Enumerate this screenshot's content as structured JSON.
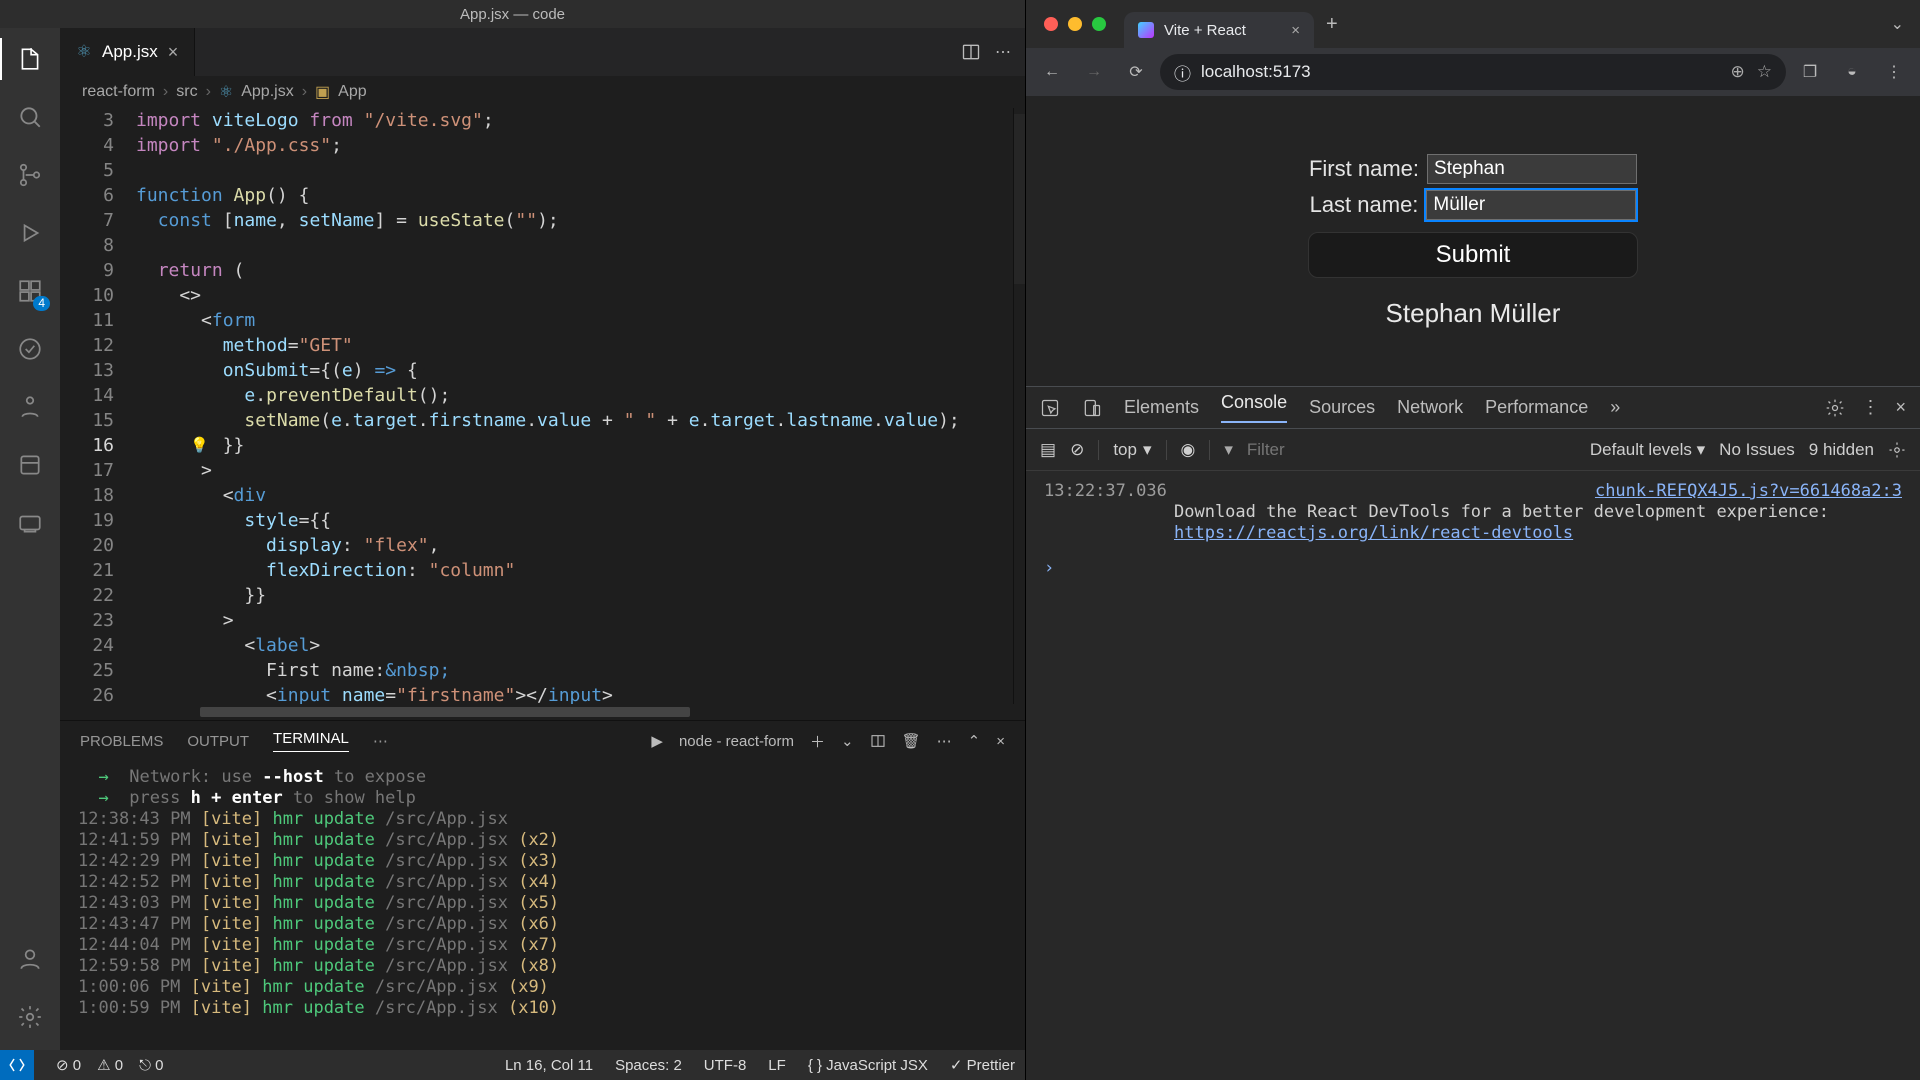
{
  "vscode": {
    "title": "App.jsx — code",
    "tab": {
      "label": "App.jsx"
    },
    "breadcrumb": [
      "react-form",
      "src",
      "App.jsx",
      "App"
    ],
    "activity_badge": "4",
    "code_lines": [
      {
        "n": 3,
        "html": "<span class='kw'>import</span> <span class='var'>viteLogo</span> <span class='kw'>from</span> <span class='str'>\"/vite.svg\"</span>;"
      },
      {
        "n": 4,
        "html": "<span class='kw'>import</span> <span class='str'>\"./App.css\"</span>;"
      },
      {
        "n": 5,
        "html": ""
      },
      {
        "n": 6,
        "html": "<span class='blue'>function</span> <span class='fn'>App</span>() {"
      },
      {
        "n": 7,
        "html": "  <span class='blue'>const</span> [<span class='var'>name</span>, <span class='var'>setName</span>] = <span class='fn'>useState</span>(<span class='str'>\"\"</span>);"
      },
      {
        "n": 8,
        "html": ""
      },
      {
        "n": 9,
        "html": "  <span class='kw'>return</span> ("
      },
      {
        "n": 10,
        "html": "    &lt;&gt;"
      },
      {
        "n": 11,
        "html": "      &lt;<span class='blue'>form</span>"
      },
      {
        "n": 12,
        "html": "        <span class='var'>method</span>=<span class='str'>\"GET\"</span>"
      },
      {
        "n": 13,
        "html": "        <span class='var'>onSubmit</span>={(<span class='var'>e</span>) <span class='blue'>=&gt;</span> {"
      },
      {
        "n": 14,
        "html": "          <span class='var'>e</span>.<span class='fn'>preventDefault</span>();"
      },
      {
        "n": 15,
        "html": "          <span class='fn'>setName</span>(<span class='var'>e</span>.<span class='var'>target</span>.<span class='var'>firstname</span>.<span class='var'>value</span> + <span class='str'>\" \"</span> + <span class='var'>e</span>.<span class='var'>target</span>.<span class='var'>lastname</span>.<span class='var'>value</span>);"
      },
      {
        "n": 16,
        "html": "        }}",
        "current": true
      },
      {
        "n": 17,
        "html": "      &gt;"
      },
      {
        "n": 18,
        "html": "        &lt;<span class='blue'>div</span>"
      },
      {
        "n": 19,
        "html": "          <span class='var'>style</span>={{"
      },
      {
        "n": 20,
        "html": "            <span class='var'>display</span>: <span class='str'>\"flex\"</span>,"
      },
      {
        "n": 21,
        "html": "            <span class='var'>flexDirection</span>: <span class='str'>\"column\"</span>"
      },
      {
        "n": 22,
        "html": "          }}"
      },
      {
        "n": 23,
        "html": "        &gt;"
      },
      {
        "n": 24,
        "html": "          &lt;<span class='blue'>label</span>&gt;"
      },
      {
        "n": 25,
        "html": "            First name:<span class='blue'>&amp;nbsp;</span>"
      },
      {
        "n": 26,
        "html": "            &lt;<span class='blue'>input</span> <span class='var'>name</span>=<span class='str'>\"firstname\"</span>&gt;&lt;/<span class='blue'>input</span>&gt;"
      }
    ],
    "panel_tabs": {
      "problems": "PROBLEMS",
      "output": "OUTPUT",
      "terminal": "TERMINAL"
    },
    "terminal_task": "node - react-form",
    "terminal_lines": [
      "  <span class='g'>→</span>  <span class='dim'>Network: use</span> <span class='w'>--host</span> <span class='dim'>to expose</span>",
      "  <span class='g'>→</span>  <span class='dim'>press</span> <span class='w'>h + enter</span> <span class='dim'>to show help</span>",
      "<span class='dim'>12:38:43 PM</span> <span class='y'>[vite]</span> <span class='g'>hmr update</span> <span class='dim'>/src/App.jsx</span>",
      "<span class='dim'>12:41:59 PM</span> <span class='y'>[vite]</span> <span class='g'>hmr update</span> <span class='dim'>/src/App.jsx</span> <span class='y'>(x2)</span>",
      "<span class='dim'>12:42:29 PM</span> <span class='y'>[vite]</span> <span class='g'>hmr update</span> <span class='dim'>/src/App.jsx</span> <span class='y'>(x3)</span>",
      "<span class='dim'>12:42:52 PM</span> <span class='y'>[vite]</span> <span class='g'>hmr update</span> <span class='dim'>/src/App.jsx</span> <span class='y'>(x4)</span>",
      "<span class='dim'>12:43:03 PM</span> <span class='y'>[vite]</span> <span class='g'>hmr update</span> <span class='dim'>/src/App.jsx</span> <span class='y'>(x5)</span>",
      "<span class='dim'>12:43:47 PM</span> <span class='y'>[vite]</span> <span class='g'>hmr update</span> <span class='dim'>/src/App.jsx</span> <span class='y'>(x6)</span>",
      "<span class='dim'>12:44:04 PM</span> <span class='y'>[vite]</span> <span class='g'>hmr update</span> <span class='dim'>/src/App.jsx</span> <span class='y'>(x7)</span>",
      "<span class='dim'>12:59:58 PM</span> <span class='y'>[vite]</span> <span class='g'>hmr update</span> <span class='dim'>/src/App.jsx</span> <span class='y'>(x8)</span>",
      "<span class='dim'>1:00:06 PM</span> <span class='y'>[vite]</span> <span class='g'>hmr update</span> <span class='dim'>/src/App.jsx</span> <span class='y'>(x9)</span>",
      "<span class='dim'>1:00:59 PM</span> <span class='y'>[vite]</span> <span class='g'>hmr update</span> <span class='dim'>/src/App.jsx</span> <span class='y'>(x10)</span>"
    ],
    "statusbar": {
      "errors": "0",
      "warnings": "0",
      "ports": "0",
      "lncol": "Ln 16, Col 11",
      "spaces": "Spaces: 2",
      "enc": "UTF-8",
      "eol": "LF",
      "lang": "JavaScript JSX",
      "prettier": "Prettier"
    }
  },
  "chrome": {
    "tab_title": "Vite + React",
    "url": "localhost:5173",
    "form": {
      "first_label": "First name:",
      "first_value": "Stephan",
      "last_label": "Last name:",
      "last_value": "Müller",
      "submit": "Submit",
      "name_output": "Stephan Müller"
    },
    "devtools": {
      "tabs": [
        "Elements",
        "Console",
        "Sources",
        "Network",
        "Performance"
      ],
      "active": "Console",
      "context": "top",
      "filter_placeholder": "Filter",
      "levels": "Default levels",
      "issues": "No Issues",
      "hidden": "9 hidden",
      "log_ts": "13:22:37.036",
      "log_src": "chunk-REFQX4J5.js?v=661468a2:3",
      "log_msg": "Download the React DevTools for a better development experience:",
      "log_link": "https://reactjs.org/link/react-devtools"
    }
  }
}
